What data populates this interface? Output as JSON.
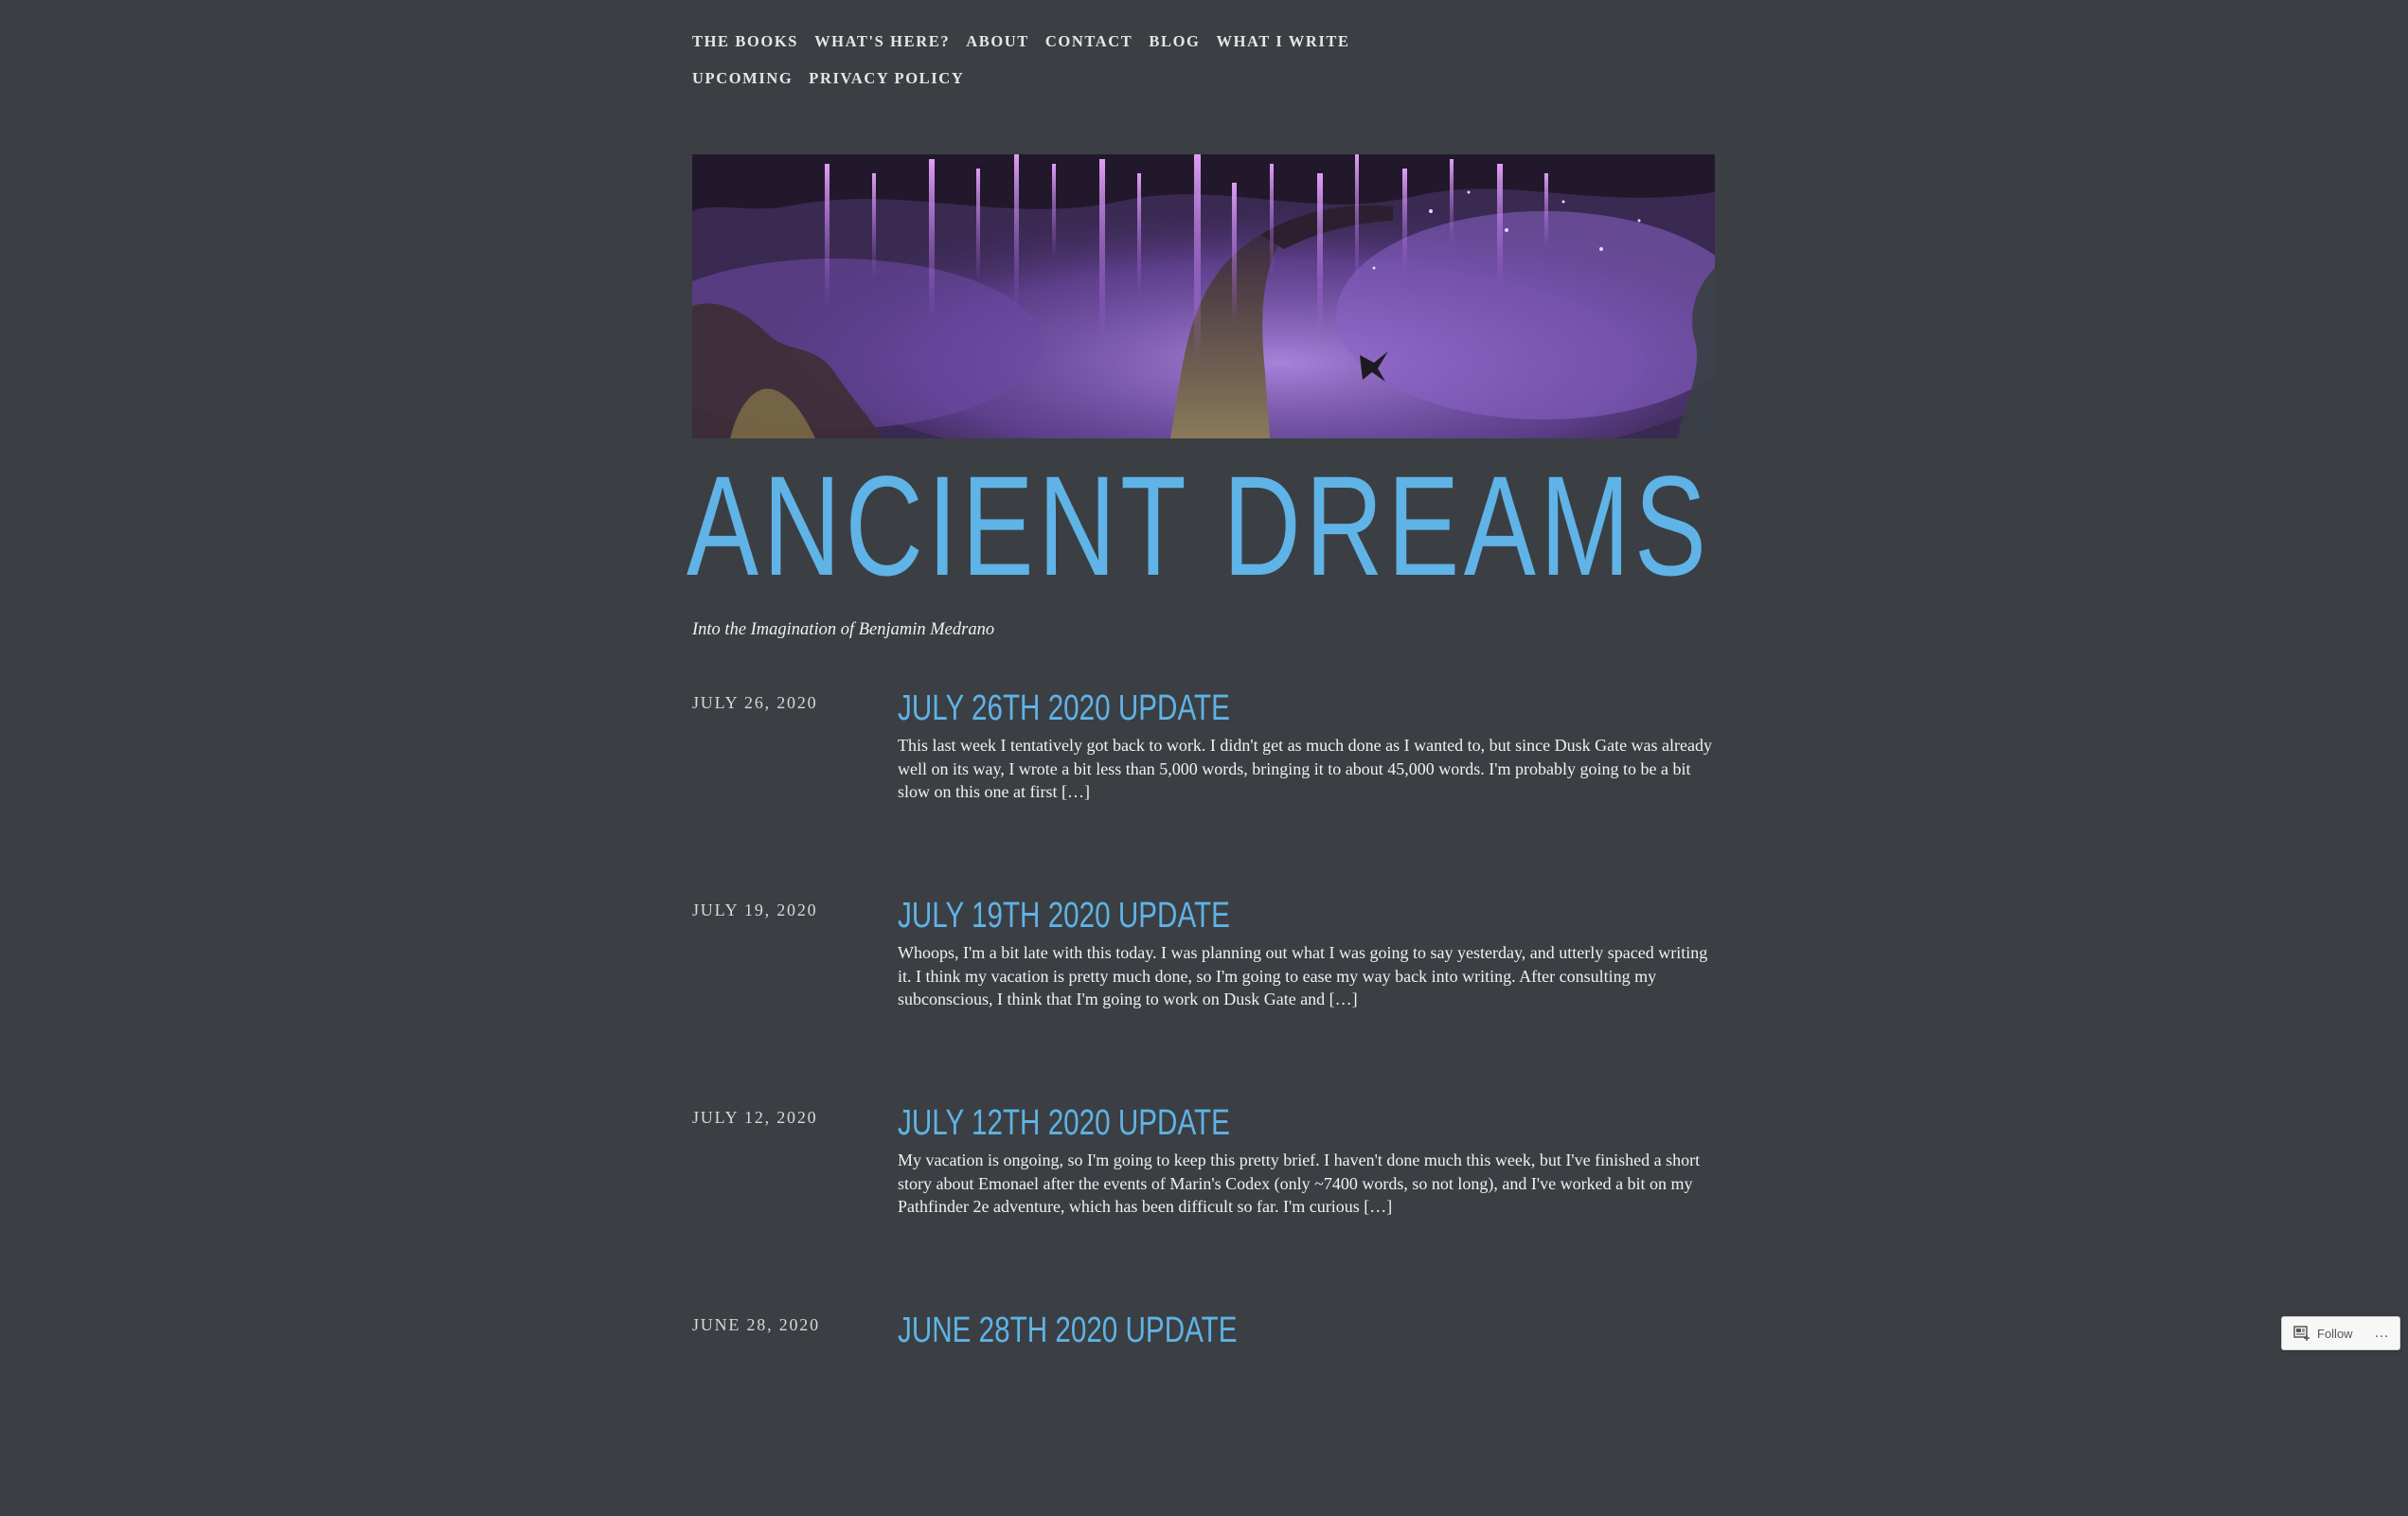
{
  "nav": {
    "row1": [
      "THE BOOKS",
      "WHAT'S HERE?",
      "ABOUT",
      "CONTACT",
      "BLOG",
      "WHAT I WRITE"
    ],
    "row2": [
      "UPCOMING",
      "PRIVACY POLICY"
    ]
  },
  "site": {
    "title": "ANCIENT DREAMS",
    "tagline": "Into the Imagination of Benjamin Medrano"
  },
  "posts": [
    {
      "date": "JULY 26, 2020",
      "title": "JULY 26TH 2020 UPDATE",
      "excerpt": "This last week I tentatively got back to work. I didn't get as much done as I wanted to, but since Dusk Gate was already well on its way, I wrote a bit less than 5,000 words, bringing it to about 45,000 words. I'm probably going to be a bit slow on this one at first […]"
    },
    {
      "date": "JULY 19, 2020",
      "title": "JULY 19TH 2020 UPDATE",
      "excerpt": "Whoops, I'm a bit late with this today. I was planning out what I was going to say yesterday, and utterly spaced writing it. I think my vacation is pretty much done, so I'm going to ease my way back into writing. After consulting my subconscious, I think that I'm going to work on Dusk Gate and […]"
    },
    {
      "date": "JULY 12, 2020",
      "title": "JULY 12TH 2020 UPDATE",
      "excerpt": "My vacation is ongoing, so I'm going to keep this pretty brief. I haven't done much this week, but I've finished a short story about Emonael after the events of Marin's Codex (only ~7400 words, so not long), and I've worked a bit on my Pathfinder 2e adventure, which has been difficult so far. I'm curious […]"
    },
    {
      "date": "JUNE 28, 2020",
      "title": "JUNE 28TH 2020 UPDATE",
      "excerpt": ""
    }
  ],
  "follow": {
    "label": "Follow",
    "more": "…",
    "icon": "follow-reader-icon"
  },
  "colors": {
    "background": "#3b3f43",
    "accent": "#5fb3e6",
    "text": "#e6e6e6"
  }
}
